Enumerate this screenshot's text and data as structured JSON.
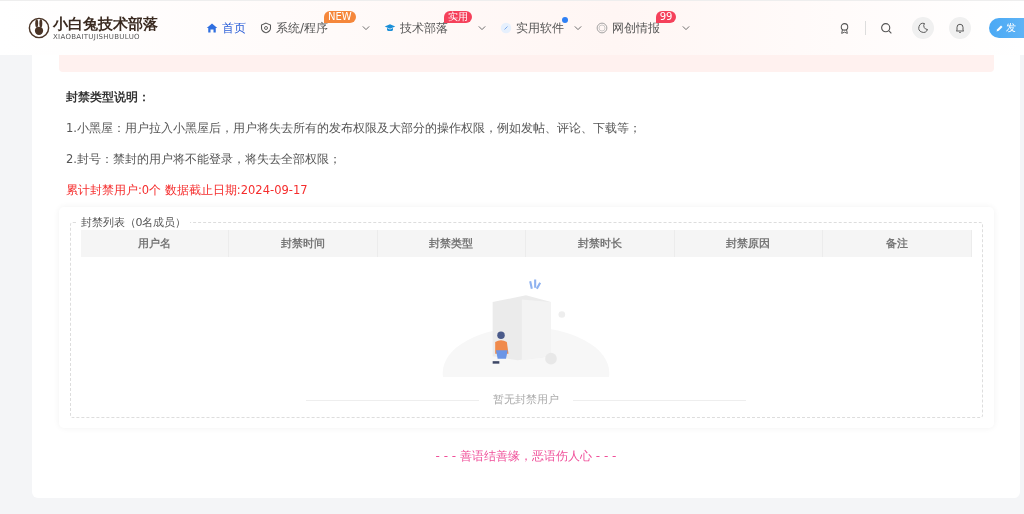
{
  "logo": {
    "title": "小白兔技术部落",
    "subtitle": "XIAOBAITUJISHUBULUO"
  },
  "nav": [
    {
      "label": "首页",
      "selected": true,
      "dropdown": false
    },
    {
      "label": "系统/程序",
      "selected": false,
      "badge": {
        "kind": "text",
        "text": "NEW",
        "color": "#f5873b"
      },
      "dropdown": true
    },
    {
      "label": "技术部落",
      "selected": false,
      "badge": {
        "kind": "text",
        "text": "实用",
        "color": "#f5415b"
      },
      "dropdown": true
    },
    {
      "label": "实用软件",
      "selected": false,
      "badge": {
        "kind": "dot",
        "color": "#2f80f5"
      },
      "dropdown": true
    },
    {
      "label": "网创情报",
      "selected": false,
      "badge": {
        "kind": "text",
        "text": "99",
        "color": "#f5415b"
      },
      "dropdown": true
    }
  ],
  "publish_button": "发",
  "notes": {
    "title": "封禁类型说明：",
    "lines": [
      "1.小黑屋：用户拉入小黑屋后，用户将失去所有的发布权限及大部分的操作权限，例如发帖、评论、下载等；",
      "2.封号：禁封的用户将不能登录，将失去全部权限；"
    ],
    "stats": "累计封禁用户:0个 数据截止日期:2024-09-17"
  },
  "list": {
    "legend": "封禁列表（0名成员）",
    "columns": [
      "用户名",
      "封禁时间",
      "封禁类型",
      "封禁时长",
      "封禁原因",
      "备注"
    ],
    "empty_text": "暂无封禁用户"
  },
  "footer_quote": "- - - 善语结善缘，恶语伤人心 - - -"
}
